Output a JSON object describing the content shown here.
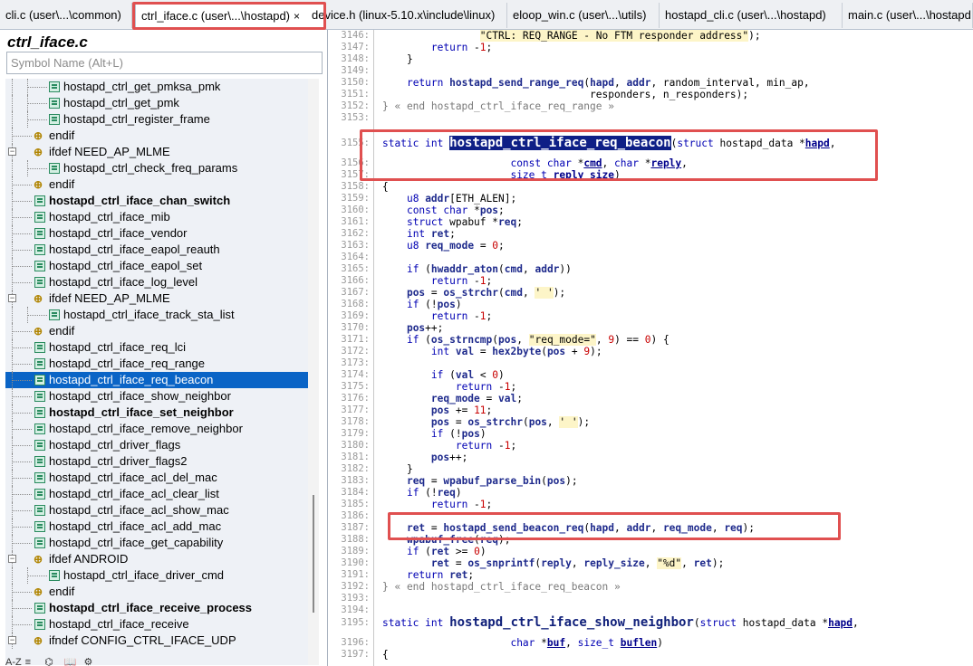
{
  "tabs": [
    {
      "label": "cli.c (user\\...\\common)"
    },
    {
      "label": "ctrl_iface.c (user\\...\\hostapd)",
      "close": "×"
    },
    {
      "label": "device.h (linux-5.10.x\\include\\linux)"
    },
    {
      "label": "eloop_win.c (user\\...\\utils)"
    },
    {
      "label": "hostapd_cli.c (user\\...\\hostapd)"
    },
    {
      "label": "main.c (user\\...\\hostapd"
    }
  ],
  "panel": {
    "title": "ctrl_iface.c",
    "search_placeholder": "Symbol Name (Alt+L)",
    "items": [
      {
        "label": "hostapd_ctrl_get_pmksa_pmk"
      },
      {
        "label": "hostapd_ctrl_get_pmk"
      },
      {
        "label": "hostapd_ctrl_register_frame"
      },
      {
        "label": "endif"
      },
      {
        "label": "ifdef NEED_AP_MLME"
      },
      {
        "label": "hostapd_ctrl_check_freq_params"
      },
      {
        "label": "endif"
      },
      {
        "label": "hostapd_ctrl_iface_chan_switch"
      },
      {
        "label": "hostapd_ctrl_iface_mib"
      },
      {
        "label": "hostapd_ctrl_iface_vendor"
      },
      {
        "label": "hostapd_ctrl_iface_eapol_reauth"
      },
      {
        "label": "hostapd_ctrl_iface_eapol_set"
      },
      {
        "label": "hostapd_ctrl_iface_log_level"
      },
      {
        "label": "ifdef NEED_AP_MLME"
      },
      {
        "label": "hostapd_ctrl_iface_track_sta_list"
      },
      {
        "label": "endif"
      },
      {
        "label": "hostapd_ctrl_iface_req_lci"
      },
      {
        "label": "hostapd_ctrl_iface_req_range"
      },
      {
        "label": "hostapd_ctrl_iface_req_beacon"
      },
      {
        "label": "hostapd_ctrl_iface_show_neighbor"
      },
      {
        "label": "hostapd_ctrl_iface_set_neighbor"
      },
      {
        "label": "hostapd_ctrl_iface_remove_neighbor"
      },
      {
        "label": "hostapd_ctrl_driver_flags"
      },
      {
        "label": "hostapd_ctrl_driver_flags2"
      },
      {
        "label": "hostapd_ctrl_iface_acl_del_mac"
      },
      {
        "label": "hostapd_ctrl_iface_acl_clear_list"
      },
      {
        "label": "hostapd_ctrl_iface_acl_show_mac"
      },
      {
        "label": "hostapd_ctrl_iface_acl_add_mac"
      },
      {
        "label": "hostapd_ctrl_iface_get_capability"
      },
      {
        "label": "ifdef ANDROID"
      },
      {
        "label": "hostapd_ctrl_iface_driver_cmd"
      },
      {
        "label": "endif"
      },
      {
        "label": "hostapd_ctrl_iface_receive_process"
      },
      {
        "label": "hostapd_ctrl_iface_receive"
      },
      {
        "label": "ifndef CONFIG_CTRL_IFACE_UDP"
      }
    ],
    "toolbar": [
      "A-Z",
      "≡",
      "⌬",
      "📖",
      "⚙"
    ]
  },
  "code": {
    "lines": [
      {
        "n": "3146:",
        "t": "                \"CTRL: REQ_RANGE - No FTM responder address\");"
      },
      {
        "n": "3147:",
        "t": "        return -1;"
      },
      {
        "n": "3148:",
        "t": "    }"
      },
      {
        "n": "3149:",
        "t": ""
      },
      {
        "n": "3150:",
        "t": "    return hostapd_send_range_req(hapd, addr, random_interval, min_ap,"
      },
      {
        "n": "3151:",
        "t": "                                  responders, n_responders);"
      },
      {
        "n": "3152:",
        "t": "} « end hostapd_ctrl_iface_req_range »"
      },
      {
        "n": "3153:",
        "t": ""
      },
      {
        "n": "3155:",
        "t": "static int hostapd_ctrl_iface_req_beacon(struct hostapd_data *hapd,"
      },
      {
        "n": "3156:",
        "t": "                     const char *cmd, char *reply,"
      },
      {
        "n": "3157:",
        "t": "                     size_t reply_size)"
      },
      {
        "n": "3158:",
        "t": "{"
      },
      {
        "n": "3159:",
        "t": "    u8 addr[ETH_ALEN];"
      },
      {
        "n": "3160:",
        "t": "    const char *pos;"
      },
      {
        "n": "3161:",
        "t": "    struct wpabuf *req;"
      },
      {
        "n": "3162:",
        "t": "    int ret;"
      },
      {
        "n": "3163:",
        "t": "    u8 req_mode = 0;"
      },
      {
        "n": "3164:",
        "t": ""
      },
      {
        "n": "3165:",
        "t": "    if (hwaddr_aton(cmd, addr))"
      },
      {
        "n": "3166:",
        "t": "        return -1;"
      },
      {
        "n": "3167:",
        "t": "    pos = os_strchr(cmd, ' ');"
      },
      {
        "n": "3168:",
        "t": "    if (!pos)"
      },
      {
        "n": "3169:",
        "t": "        return -1;"
      },
      {
        "n": "3170:",
        "t": "    pos++;"
      },
      {
        "n": "3171:",
        "t": "    if (os_strncmp(pos, \"req_mode=\", 9) == 0) {"
      },
      {
        "n": "3172:",
        "t": "        int val = hex2byte(pos + 9);"
      },
      {
        "n": "3173:",
        "t": ""
      },
      {
        "n": "3174:",
        "t": "        if (val < 0)"
      },
      {
        "n": "3175:",
        "t": "            return -1;"
      },
      {
        "n": "3176:",
        "t": "        req_mode = val;"
      },
      {
        "n": "3177:",
        "t": "        pos += 11;"
      },
      {
        "n": "3178:",
        "t": "        pos = os_strchr(pos, ' ');"
      },
      {
        "n": "3179:",
        "t": "        if (!pos)"
      },
      {
        "n": "3180:",
        "t": "            return -1;"
      },
      {
        "n": "3181:",
        "t": "        pos++;"
      },
      {
        "n": "3182:",
        "t": "    }"
      },
      {
        "n": "3183:",
        "t": "    req = wpabuf_parse_bin(pos);"
      },
      {
        "n": "3184:",
        "t": "    if (!req)"
      },
      {
        "n": "3185:",
        "t": "        return -1;"
      },
      {
        "n": "3186:",
        "t": ""
      },
      {
        "n": "3187:",
        "t": "    ret = hostapd_send_beacon_req(hapd, addr, req_mode, req);"
      },
      {
        "n": "3188:",
        "t": "    wpabuf_free(req);"
      },
      {
        "n": "3189:",
        "t": "    if (ret >= 0)"
      },
      {
        "n": "3190:",
        "t": "        ret = os_snprintf(reply, reply_size, \"%d\", ret);"
      },
      {
        "n": "3191:",
        "t": "    return ret;"
      },
      {
        "n": "3192:",
        "t": "} « end hostapd_ctrl_iface_req_beacon »"
      },
      {
        "n": "3193:",
        "t": ""
      },
      {
        "n": "3194:",
        "t": ""
      },
      {
        "n": "3195:",
        "t": "static int hostapd_ctrl_iface_show_neighbor(struct hostapd_data *hapd,"
      },
      {
        "n": "3196:",
        "t": "                     char *buf, size_t buflen)"
      },
      {
        "n": "3197:",
        "t": "{"
      }
    ]
  },
  "colors": {
    "selection": "#0a64c6",
    "annotation_box": "#e05050",
    "tree_bg": "#eef1f6"
  }
}
